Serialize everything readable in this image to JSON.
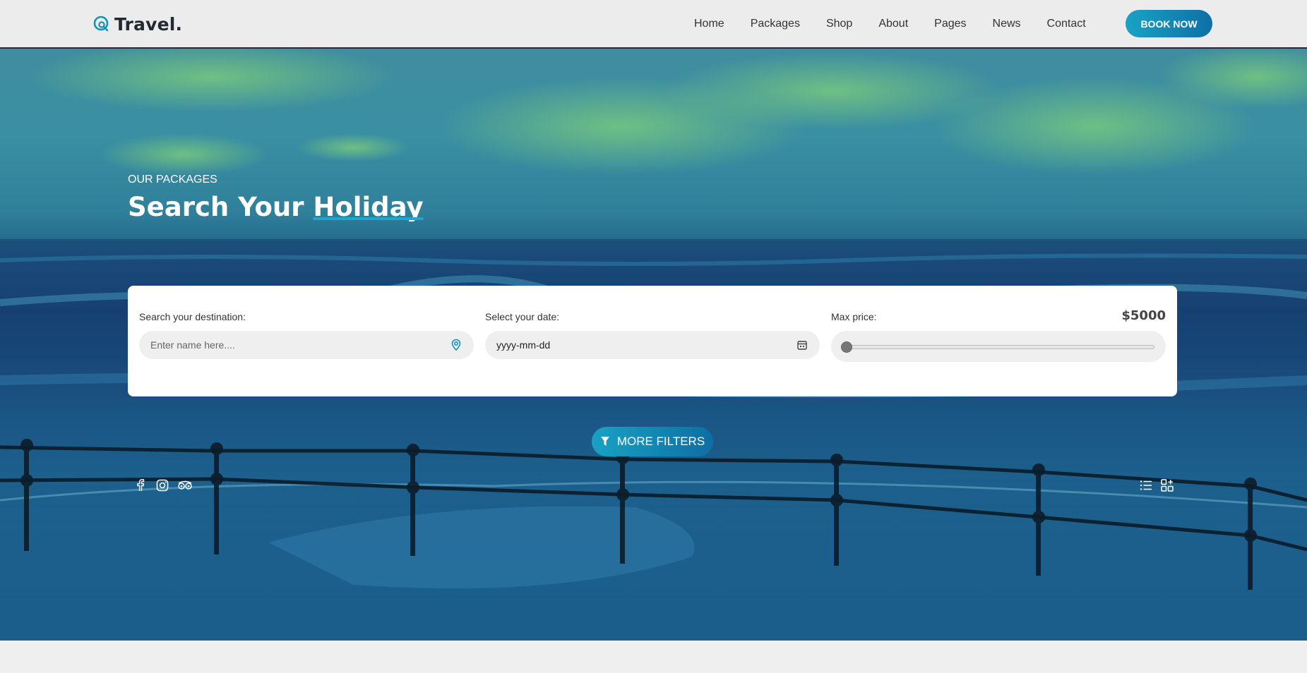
{
  "brand": {
    "logo_text": "Travel."
  },
  "nav": {
    "items": [
      {
        "label": "Home"
      },
      {
        "label": "Packages"
      },
      {
        "label": "Shop"
      },
      {
        "label": "About"
      },
      {
        "label": "Pages"
      },
      {
        "label": "News"
      },
      {
        "label": "Contact"
      }
    ],
    "cta_label": "BOOK NOW"
  },
  "hero": {
    "eyebrow": "OUR PACKAGES",
    "title_prefix": "Search Your",
    "title_highlight": "Holiday"
  },
  "search": {
    "destination": {
      "label": "Search your destination:",
      "placeholder": "Enter name here...."
    },
    "date": {
      "label": "Select your date:",
      "value": "yyyy-mm-dd"
    },
    "price": {
      "label": "Max price:",
      "value_text": "$5000",
      "slider_fraction": 0.0
    },
    "more_filters_label": "MORE FILTERS"
  },
  "social": {
    "icons": [
      "facebook-icon",
      "instagram-icon",
      "tripadvisor-icon"
    ]
  },
  "view_toggle": {
    "icons": [
      "list-view-icon",
      "grid-view-icon"
    ]
  },
  "colors": {
    "accent": "#1ea6cf",
    "accent_dark": "#0f6fa6",
    "header_bg": "#ececec",
    "page_bg": "#efefef"
  }
}
